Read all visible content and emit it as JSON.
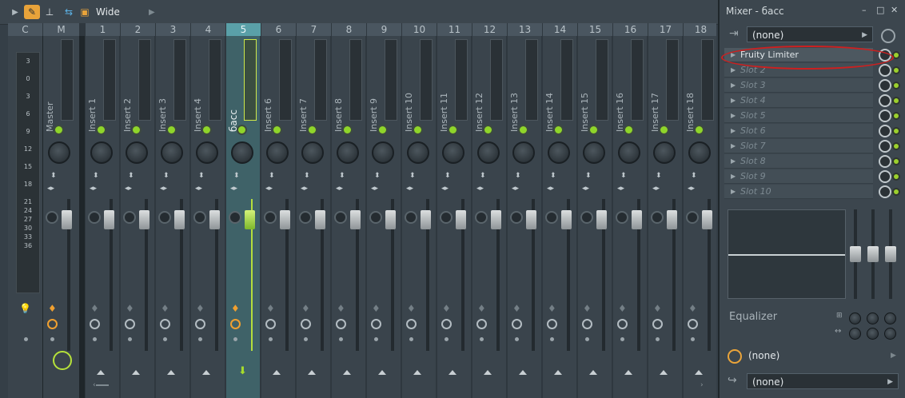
{
  "toolbar": {
    "layout_label": "Wide"
  },
  "mixer": {
    "headers": [
      "C",
      "M",
      "1",
      "2",
      "3",
      "4",
      "5",
      "6",
      "7",
      "8",
      "9",
      "10",
      "11",
      "12",
      "13",
      "14",
      "15",
      "16",
      "17",
      "18"
    ],
    "scale": [
      "3",
      "0",
      "3",
      "6",
      "9",
      "12",
      "15",
      "18",
      "21",
      "24",
      "27",
      "30",
      "33",
      "36"
    ],
    "master_name": "Master",
    "insert_names": [
      "Insert 1",
      "Insert 2",
      "Insert 3",
      "Insert 4",
      "бacc",
      "Insert 6",
      "Insert 7",
      "Insert 8",
      "Insert 9",
      "Insert 10",
      "Insert 11",
      "Insert 12",
      "Insert 13",
      "Insert 14",
      "Insert 15",
      "Insert 16",
      "Insert 17",
      "Insert 18"
    ],
    "selected_index": 5
  },
  "panel": {
    "title": "Mixer - бacc",
    "window_controls": [
      "–",
      "□",
      "✕"
    ],
    "input_select": "(none)",
    "slots": [
      "Fruity Limiter",
      "Slot 2",
      "Slot 3",
      "Slot 4",
      "Slot 5",
      "Slot 6",
      "Slot 7",
      "Slot 8",
      "Slot 9",
      "Slot 10"
    ],
    "eq_label": "Equalizer",
    "eq_symbols": [
      "⊞",
      "↔"
    ],
    "time_select": "(none)",
    "output_select": "(none)"
  },
  "colors": {
    "accent": "#e8a33a",
    "selected_strip": "#3f6268",
    "led_green": "#8fd52a",
    "annotation_red": "#cc2020"
  }
}
